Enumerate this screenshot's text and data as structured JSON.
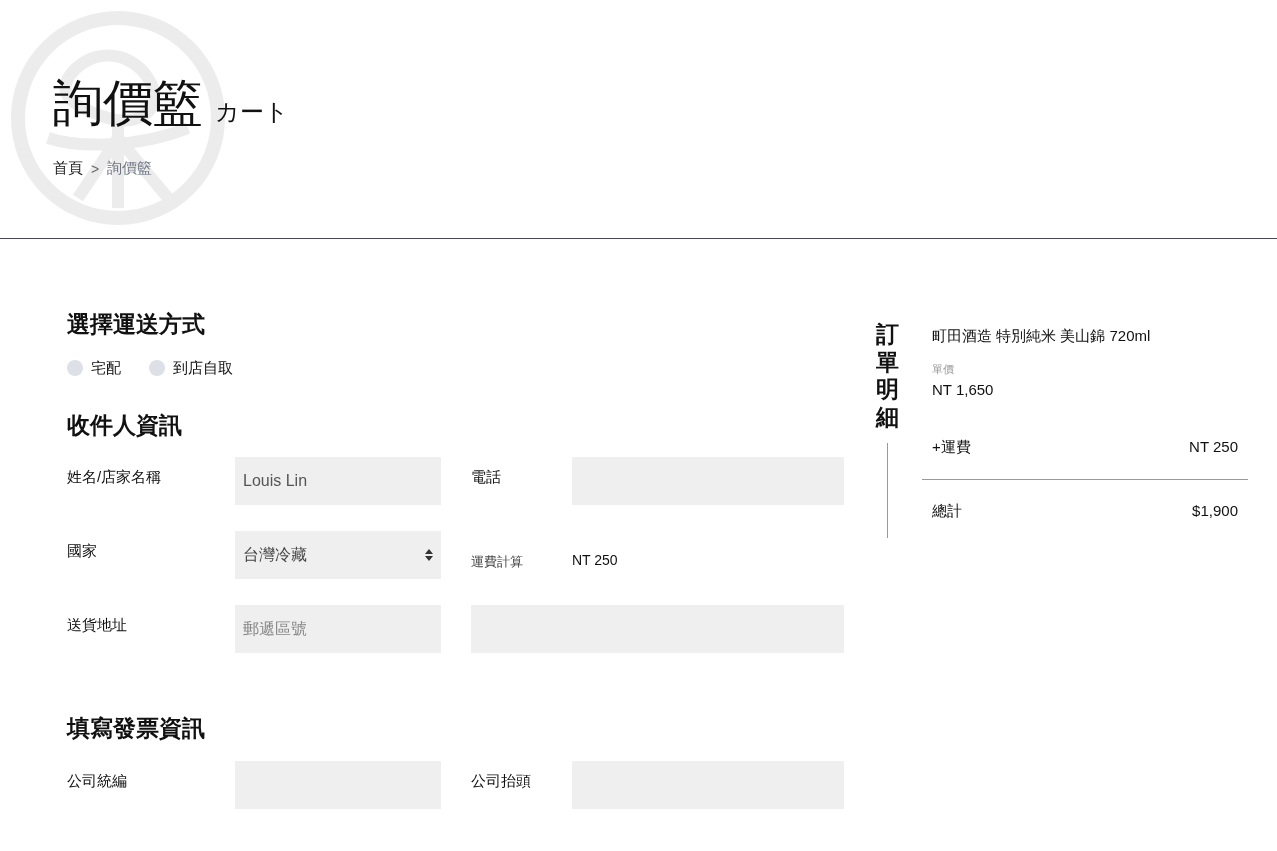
{
  "header": {
    "title": "詢價籃",
    "subtitle": "カート",
    "separator": ">",
    "breadcrumb": [
      {
        "label": "首頁",
        "selected": false
      },
      {
        "label": "詢價籃",
        "selected": true
      }
    ]
  },
  "shipping": {
    "heading": "選擇運送方式",
    "options": [
      {
        "label": "宅配",
        "selected": false
      },
      {
        "label": "到店自取",
        "selected": false
      }
    ]
  },
  "recipient": {
    "heading": "收件人資訊",
    "rows": [
      [
        {
          "kind": "field",
          "label": "姓名/店家名稱",
          "value": "Louis Lin"
        },
        {
          "kind": "field",
          "label": "電話"
        }
      ],
      [
        {
          "kind": "select",
          "label": "國家",
          "value": "台灣冷藏"
        },
        {
          "kind": "info",
          "label": "運費計算",
          "value": "NT 250"
        }
      ],
      [
        {
          "kind": "field",
          "label": "送貨地址",
          "placeholder": "郵遞區號"
        },
        {
          "kind": "wide"
        }
      ]
    ]
  },
  "invoice": {
    "heading": "填寫發票資訊",
    "rows": [
      [
        {
          "kind": "field",
          "label": "公司統編"
        },
        {
          "kind": "field",
          "label": "公司抬頭"
        }
      ]
    ]
  },
  "order": {
    "heading": "訂單明細",
    "items": [
      {
        "name": "町田酒造 特別純米 美山錦 720ml",
        "price_label": "單價",
        "price": "NT 1,650"
      }
    ],
    "shipping": {
      "label": "+運費",
      "value": "NT 250"
    },
    "total": {
      "label": "總計",
      "value": "$1,900"
    }
  }
}
